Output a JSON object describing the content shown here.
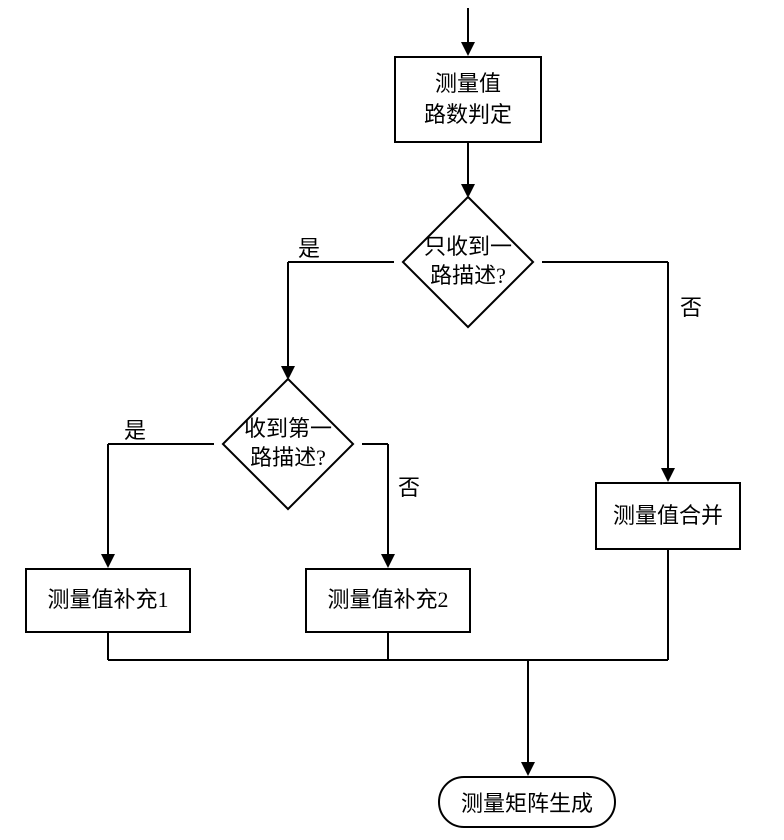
{
  "chart_data": {
    "type": "flowchart",
    "title": "",
    "nodes": [
      {
        "id": "start_arrow",
        "type": "entry",
        "label": ""
      },
      {
        "id": "n1",
        "type": "process",
        "label": [
          "测量值",
          "路数判定"
        ]
      },
      {
        "id": "d1",
        "type": "decision",
        "label": [
          "只收到一",
          "路描述?"
        ]
      },
      {
        "id": "d2",
        "type": "decision",
        "label": [
          "收到第一",
          "路描述?"
        ]
      },
      {
        "id": "n2",
        "type": "process",
        "label": [
          "测量值合并"
        ]
      },
      {
        "id": "n3",
        "type": "process",
        "label": [
          "测量值补充1"
        ]
      },
      {
        "id": "n4",
        "type": "process",
        "label": [
          "测量值补充2"
        ]
      },
      {
        "id": "n5",
        "type": "terminal",
        "label": [
          "测量矩阵生成"
        ]
      }
    ],
    "edges": [
      {
        "from": "start_arrow",
        "to": "n1",
        "label": ""
      },
      {
        "from": "n1",
        "to": "d1",
        "label": ""
      },
      {
        "from": "d1",
        "to": "d2",
        "label": "是"
      },
      {
        "from": "d1",
        "to": "n2",
        "label": "否"
      },
      {
        "from": "d2",
        "to": "n3",
        "label": "是"
      },
      {
        "from": "d2",
        "to": "n4",
        "label": "否"
      },
      {
        "from": "n3",
        "to": "n5",
        "label": ""
      },
      {
        "from": "n4",
        "to": "n5",
        "label": ""
      },
      {
        "from": "n2",
        "to": "n5",
        "label": ""
      }
    ]
  },
  "labels": {
    "n1_line1": "测量值",
    "n1_line2": "路数判定",
    "d1_line1": "只收到一",
    "d1_line2": "路描述?",
    "d2_line1": "收到第一",
    "d2_line2": "路描述?",
    "n2": "测量值合并",
    "n3": "测量值补充1",
    "n4": "测量值补充2",
    "n5": "测量矩阵生成",
    "yes": "是",
    "no": "否"
  }
}
